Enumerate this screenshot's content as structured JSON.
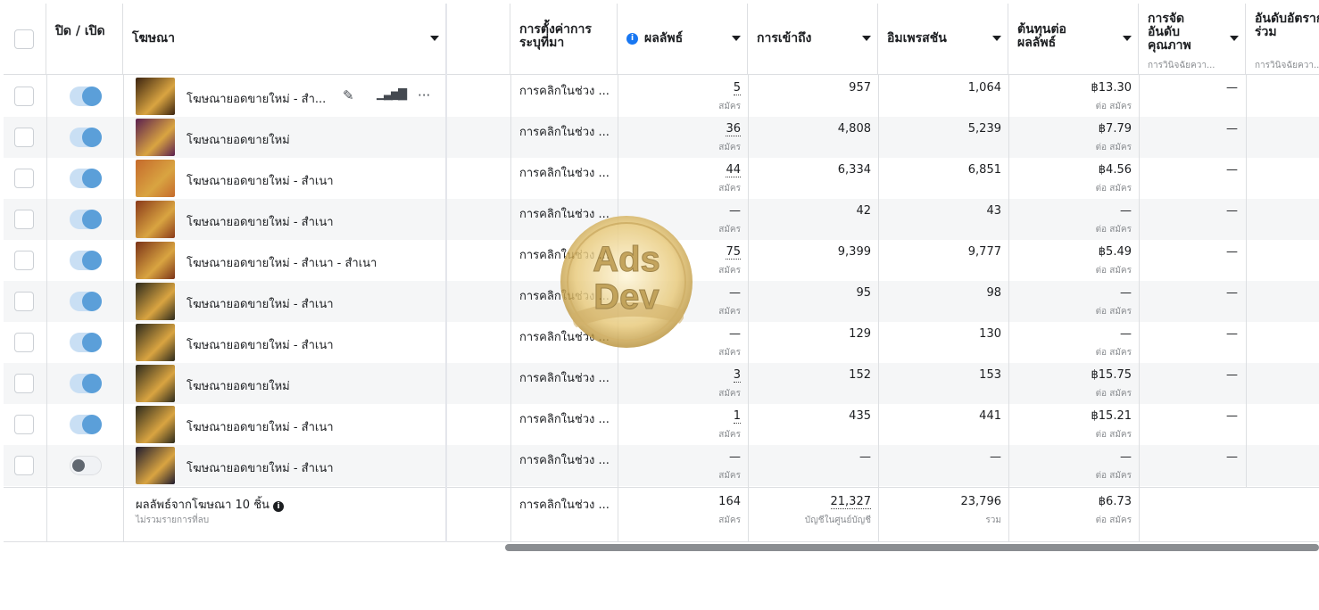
{
  "header": {
    "onoff": "ปิด / เปิด",
    "ad": "โฆษณา",
    "attribution": "การตั้งค่าการระบุที่มา",
    "results": "ผลลัพธ์",
    "reach": "การเข้าถึง",
    "impressions": "อิมเพรสชัน",
    "cpr": "ต้นทุนต่อผลลัพธ์",
    "quality": "การจัดอันดับคุณภาพ",
    "quality_sub": "การวินิจฉัยควา...",
    "engagement": "อันดับอัตราการมีส่วนร่วม",
    "engagement_sub": "การวินิจฉัยควา..."
  },
  "rows": [
    {
      "name": "โฆษณายอดขายใหม่ - สำ...",
      "on": true,
      "attr": "การคลิกในช่วง ...",
      "result": "5",
      "result_unit": "สมัคร",
      "reach": "957",
      "impr": "1,064",
      "cpr": "฿13.30",
      "cpr_unit": "ต่อ สมัคร",
      "quality": "—",
      "thumb": "#3b2410"
    },
    {
      "name": "โฆษณายอดขายใหม่",
      "on": true,
      "attr": "การคลิกในช่วง ...",
      "result": "36",
      "result_unit": "สมัคร",
      "reach": "4,808",
      "impr": "5,239",
      "cpr": "฿7.79",
      "cpr_unit": "ต่อ สมัคร",
      "quality": "—",
      "thumb": "#5a1f4f"
    },
    {
      "name": "โฆษณายอดขายใหม่ - สำเนา",
      "on": true,
      "attr": "การคลิกในช่วง ...",
      "result": "44",
      "result_unit": "สมัคร",
      "reach": "6,334",
      "impr": "6,851",
      "cpr": "฿4.56",
      "cpr_unit": "ต่อ สมัคร",
      "quality": "—",
      "thumb": "#c56a2c"
    },
    {
      "name": "โฆษณายอดขายใหม่ - สำเนา",
      "on": true,
      "attr": "การคลิกในช่วง ...",
      "result": "—",
      "result_unit": "สมัคร",
      "reach": "42",
      "impr": "43",
      "cpr": "—",
      "cpr_unit": "ต่อ สมัคร",
      "quality": "—",
      "thumb": "#8a3a1a"
    },
    {
      "name": "โฆษณายอดขายใหม่ - สำเนา - สำเนา",
      "on": true,
      "attr": "การคลิกในช่วง ...",
      "result": "75",
      "result_unit": "สมัคร",
      "reach": "9,399",
      "impr": "9,777",
      "cpr": "฿5.49",
      "cpr_unit": "ต่อ สมัคร",
      "quality": "—",
      "thumb": "#7b3318"
    },
    {
      "name": "โฆษณายอดขายใหม่ - สำเนา",
      "on": true,
      "attr": "การคลิกในช่วง ...",
      "result": "—",
      "result_unit": "สมัคร",
      "reach": "95",
      "impr": "98",
      "cpr": "—",
      "cpr_unit": "ต่อ สมัคร",
      "quality": "—",
      "thumb": "#2d2a1c"
    },
    {
      "name": "โฆษณายอดขายใหม่ - สำเนา",
      "on": true,
      "attr": "การคลิกในช่วง ...",
      "result": "—",
      "result_unit": "สมัคร",
      "reach": "129",
      "impr": "130",
      "cpr": "—",
      "cpr_unit": "ต่อ สมัคร",
      "quality": "—",
      "thumb": "#2d2a1c"
    },
    {
      "name": "โฆษณายอดขายใหม่",
      "on": true,
      "attr": "การคลิกในช่วง ...",
      "result": "3",
      "result_unit": "สมัคร",
      "reach": "152",
      "impr": "153",
      "cpr": "฿15.75",
      "cpr_unit": "ต่อ สมัคร",
      "quality": "—",
      "thumb": "#2d2a1c"
    },
    {
      "name": "โฆษณายอดขายใหม่ - สำเนา",
      "on": true,
      "attr": "การคลิกในช่วง ...",
      "result": "1",
      "result_unit": "สมัคร",
      "reach": "435",
      "impr": "441",
      "cpr": "฿15.21",
      "cpr_unit": "ต่อ สมัคร",
      "quality": "—",
      "thumb": "#2d2a1c"
    },
    {
      "name": "โฆษณายอดขายใหม่ - สำเนา",
      "on": false,
      "attr": "การคลิกในช่วง ...",
      "result": "—",
      "result_unit": "สมัคร",
      "reach": "—",
      "impr": "—",
      "cpr": "—",
      "cpr_unit": "ต่อ สมัคร",
      "quality": "—",
      "thumb": "#1f1b2e"
    }
  ],
  "footer": {
    "label": "ผลลัพธ์จากโฆษณา 10 ชิ้น",
    "sublabel": "ไม่รวมรายการที่ลบ",
    "attr": "การคลิกในช่วง ...",
    "result": "164",
    "result_unit": "สมัคร",
    "reach": "21,327",
    "reach_unit": "บัญชีในศูนย์บัญชี",
    "impr": "23,796",
    "impr_unit": "รวม",
    "cpr": "฿6.73",
    "cpr_unit": "ต่อ สมัคร"
  },
  "watermark": {
    "line1": "Ads",
    "line2": "Dev"
  },
  "colors": {
    "toggle_on": "#5b9fd9",
    "info": "#1877f2",
    "watermark_gold": "#e3c36b"
  }
}
